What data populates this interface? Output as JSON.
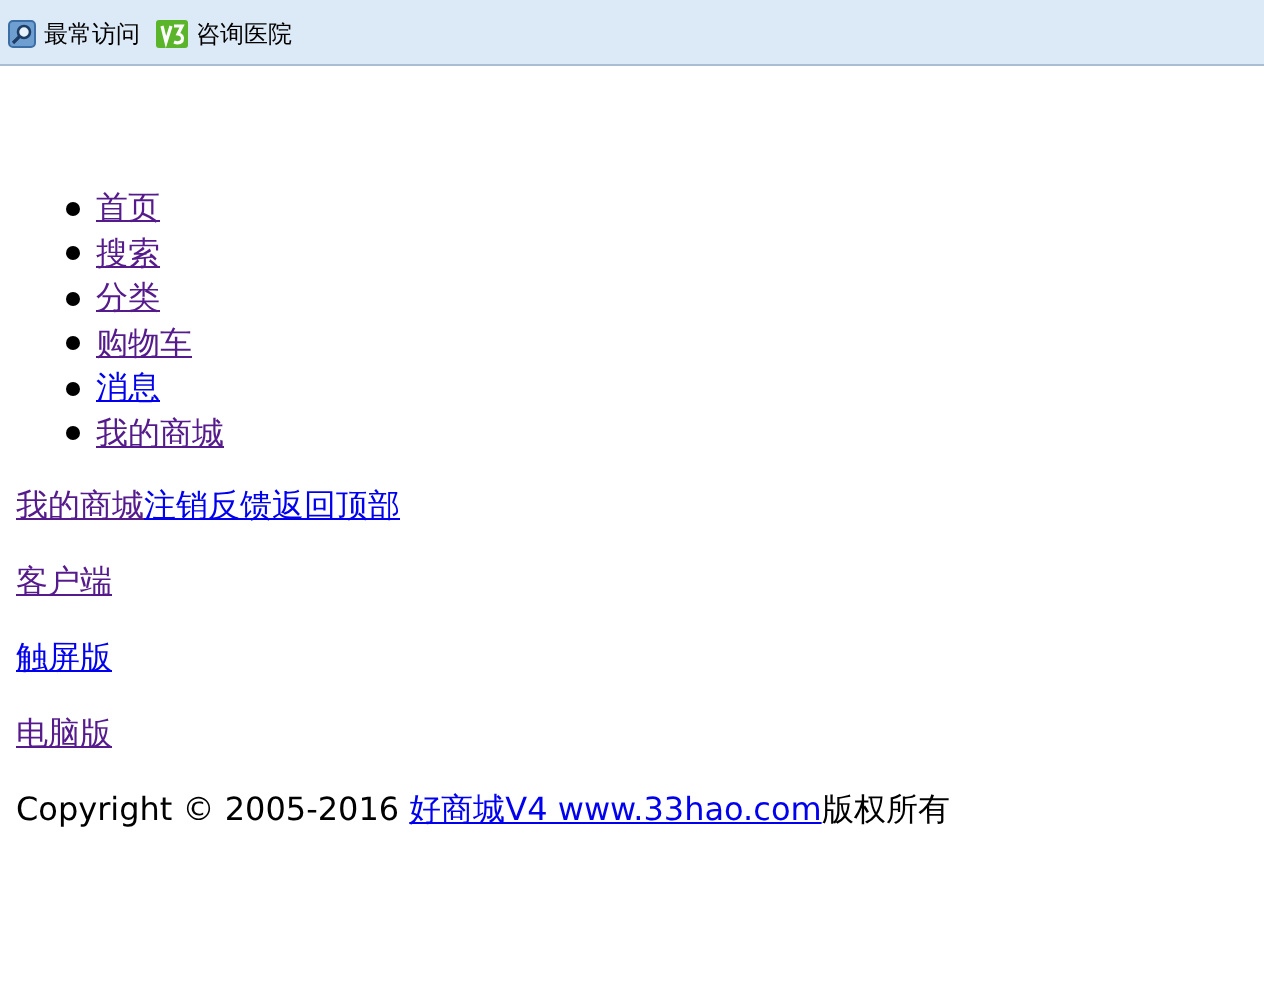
{
  "bookmarks_bar": [
    {
      "label": "最常访问",
      "kind": "search"
    },
    {
      "label": "咨询医院",
      "kind": "v3"
    }
  ],
  "nav": [
    {
      "label": "首页",
      "visited": true
    },
    {
      "label": "搜索",
      "visited": true
    },
    {
      "label": "分类",
      "visited": true
    },
    {
      "label": "购物车",
      "visited": true
    },
    {
      "label": "消息",
      "visited": false
    },
    {
      "label": "我的商城",
      "visited": true
    }
  ],
  "footer_links": [
    {
      "label": "我的商城",
      "visited": true
    },
    {
      "label": "注销",
      "visited": false
    },
    {
      "label": "反馈",
      "visited": false
    },
    {
      "label": "返回顶部",
      "visited": false
    }
  ],
  "version_links": [
    {
      "label": "客户端",
      "visited": true
    },
    {
      "label": "触屏版",
      "visited": false
    },
    {
      "label": "电脑版",
      "visited": true
    }
  ],
  "copyright": {
    "text": "Copyright © 2005-2016 ",
    "link": {
      "label": "好商城V4 www.33hao.com",
      "visited": false
    },
    "suffix": "版权所有"
  }
}
